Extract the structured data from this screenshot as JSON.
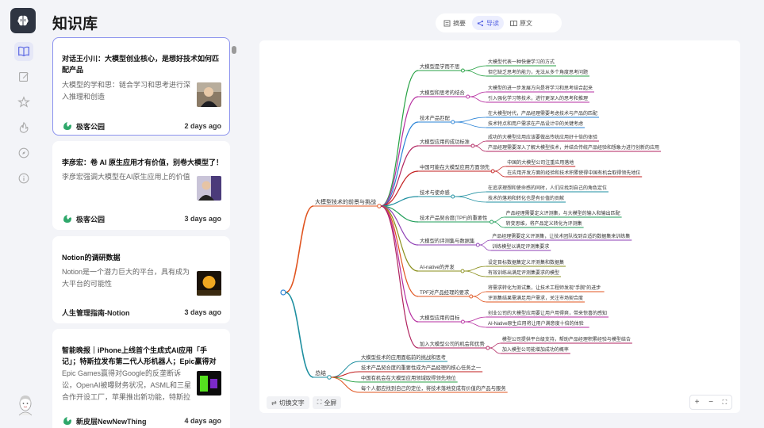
{
  "page_title": "知识库",
  "rail": {
    "items": [
      {
        "name": "knowledge-base",
        "icon": "book-icon",
        "active": true
      },
      {
        "name": "notes",
        "icon": "edit-icon",
        "active": false
      },
      {
        "name": "favorites",
        "icon": "star-icon",
        "active": false
      },
      {
        "name": "hot",
        "icon": "flame-icon",
        "active": false
      },
      {
        "name": "discover",
        "icon": "compass-icon",
        "active": false
      },
      {
        "name": "info",
        "icon": "info-icon",
        "active": false
      }
    ]
  },
  "articles": [
    {
      "title": "对话王小川：大模型创业核心，是想好技术如何匹配产品",
      "summary": "大模型的学和思：链合学习和思考进行深入推理和创造",
      "source": "极客公园",
      "source_icon": "geekpark-icon",
      "date": "2 days ago",
      "selected": true
    },
    {
      "title": "李彦宏：卷 AI 原生应用才有价值，别卷大模型了！",
      "summary": "李彦宏强调大模型在AI原生应用上的价值",
      "source": "极客公园",
      "source_icon": "geekpark-icon",
      "date": "3 days ago",
      "selected": false
    },
    {
      "title": "Notion的调研数据",
      "summary": "Notion是一个潜力巨大的平台，具有成为大平台的可能性",
      "source": "人生管理指南-Notion",
      "source_icon": "",
      "date": "3 days ago",
      "selected": false
    },
    {
      "title": "智能晚报｜iPhone上线首个生成式AI应用「手记」；特斯拉发布第二代人形机器人；Epic赢得对",
      "summary": "Epic Games赢得对Google的反垄断诉讼，OpenAI被曝财务状况，ASML和三星合作开设工厂，苹果推出新功能，特斯拉",
      "source": "新皮层NewNewThing",
      "source_icon": "newthing-icon",
      "date": "4 days ago",
      "selected": false
    }
  ],
  "tabs": [
    {
      "label": "摘要",
      "icon": "summary-icon",
      "active": false
    },
    {
      "label": "导读",
      "icon": "mindmap-icon",
      "active": true
    },
    {
      "label": "原文",
      "icon": "original-icon",
      "active": false
    }
  ],
  "toolbar": {
    "switch_text": "切换文字",
    "fullscreen": "全屏"
  },
  "zoom": {
    "plus": "+",
    "minus": "−",
    "fit": "⛶"
  },
  "mindmap": {
    "branches": [
      {
        "label": "大模型技术的前景与挑战",
        "color": "#e0541f",
        "children": [
          {
            "label": "大模型是学而不思",
            "color": "#27a244",
            "children": [
              "大模型代表一种快捷学习的方式",
              "但它缺乏思考的能力，无法从多个角度思考问题"
            ]
          },
          {
            "label": "大模型和思考的结合",
            "color": "#b62ea0",
            "children": [
              "大模型的进一步发展方向是将学习和思考结合起来",
              "引入强化学习等技术，进行更深入的思考和推理"
            ]
          },
          {
            "label": "技术产品匹配",
            "color": "#2a83d6",
            "children": [
              "在大模型时代，产品经理需要考虑技术与产品的匹配",
              "技术特点和用户需求在产品设计中的关键考虑"
            ]
          },
          {
            "label": "大模型应用的成功标准",
            "color": "#b0235f",
            "children": [
              "成功的大模型应用应该要做出传统应用好十倍的体验",
              "产品经理需要深入了解大模型技术，并结合传统产品经验和想象力进行创新的应用"
            ]
          },
          {
            "label": "中国可能在大模型应用方面领先",
            "color": "#c21e1e",
            "children": [
              "中国的大模型公司注重应用落地",
              "在应用开发方面的经验和技术积累使得中国有机会取得领先地位"
            ]
          },
          {
            "label": "技术与使命感",
            "color": "#1e8fa0",
            "children": [
              "在追求理想和使命感的同时，人们应找到自己的角色定位",
              "技术的落地和转化也是有价值的贡献"
            ]
          },
          {
            "label": "技术产品契合度(TPF)的重要性",
            "color": "#1f9d58",
            "children": [
              "产品经理需要定义评测集，与大模型的输入和输出匹配",
              "转变思维，将产品定义转化为评测集"
            ]
          },
          {
            "label": "大模型的评测集与数据集",
            "color": "#8e3fb5",
            "children": [
              "产品经理需要定义评测集，让技术团队找到合适的数据集来训练集",
              "训练模型以满足评测集要求"
            ]
          },
          {
            "label": "AI-native的开发",
            "color": "#8a8f1b",
            "children": [
              "设定目标数据集定义评测集和数据集",
              "有效训练出满足评测集要求的模型"
            ]
          },
          {
            "label": "TPF对产品经理的要求",
            "color": "#e0541f",
            "children": [
              "将需求转化为测试集，让技术工程师发现\"手腕\"的进步",
              "评测集结果需满足用户需求，关注市场契合度"
            ]
          },
          {
            "label": "大模型应用的目标",
            "color": "#b62ea0",
            "children": [
              "创业公司的大模型应用要让用户用得爽，带来惊喜的感知",
              "AI-Native原生应用将让用户满意度十倍的体验"
            ]
          },
          {
            "label": "加入大模型公司的机会和优势",
            "color": "#b0235f",
            "children": [
              "模型公司提供平台级支持，帮助产品经理积累经验与模型结合",
              "加入模型公司能增加成功的概率"
            ]
          }
        ]
      },
      {
        "label": "总结",
        "color": "#1e8fa0",
        "children": [
          {
            "label": "大模型技术的应用面临前的挑战和思考",
            "color": "#1e8fa0",
            "children": []
          },
          {
            "label": "技术产品契合度的重要性成为产品经理的核心任务之一",
            "color": "#c21e1e",
            "children": []
          },
          {
            "label": "中国有机会在大模型应用领域取得领先地位",
            "color": "#27a244",
            "children": []
          },
          {
            "label": "每个人都应找到自己的定位，将技术落地变成有价值的产品与服务",
            "color": "#e0541f",
            "children": []
          }
        ]
      }
    ]
  }
}
